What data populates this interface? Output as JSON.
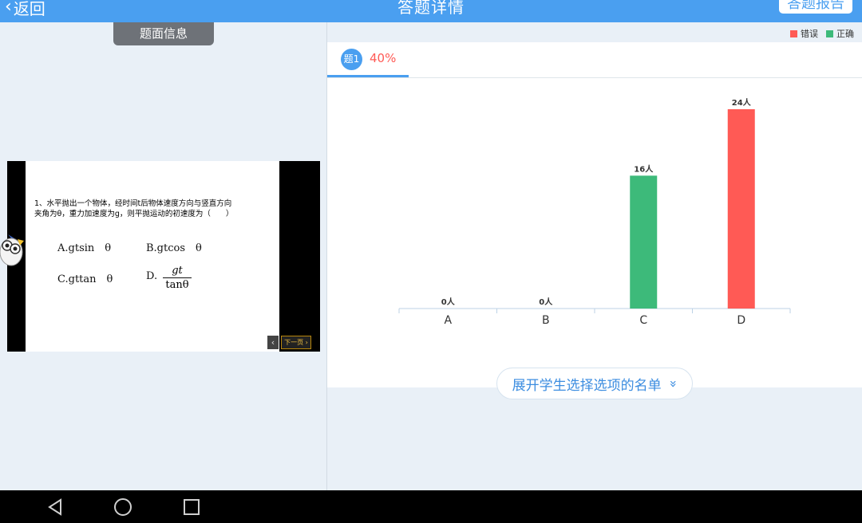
{
  "header": {
    "back_label": "返回",
    "title": "答题详情",
    "report_label": "答题报告"
  },
  "left": {
    "tab_label": "题面信息",
    "question_line1": "1、水平抛出一个物体，经时间t后物体速度方向与竖直方向",
    "question_line2": "夹角为θ，重力加速度为g，则平抛运动的初速度为（　　）",
    "option_a": "A.gtsin　θ",
    "option_b": "B.gtcos　θ",
    "option_c": "C.gttan　θ",
    "option_d_prefix": "D.",
    "option_d_num": "gt",
    "option_d_den": "tanθ",
    "prev_label": "‹",
    "next_label": "下一页 ›"
  },
  "right": {
    "legend": {
      "wrong": "错误",
      "correct": "正确"
    },
    "tab_badge": "题1",
    "tab_rate": "40%",
    "expand_label": "展开学生选择选项的名单",
    "expand_icon": "»"
  },
  "colors": {
    "wrong": "#ff5a55",
    "correct": "#3dba7a",
    "accent": "#4a9ff0"
  },
  "chart_data": {
    "type": "bar",
    "categories": [
      "A",
      "B",
      "C",
      "D"
    ],
    "values": [
      0,
      0,
      16,
      24
    ],
    "labels": [
      "0人",
      "0人",
      "16人",
      "24人"
    ],
    "status": [
      "none",
      "none",
      "correct",
      "wrong"
    ],
    "ylim": [
      0,
      24
    ]
  }
}
